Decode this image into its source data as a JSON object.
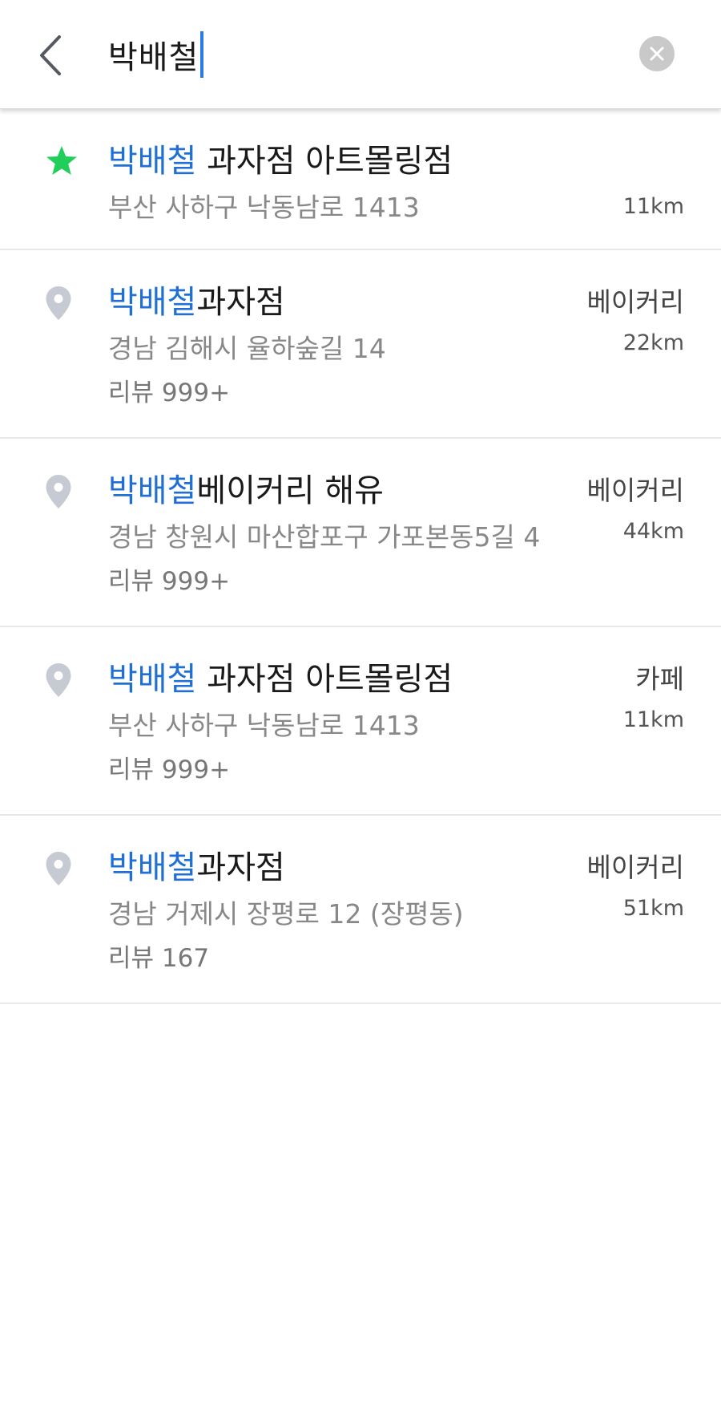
{
  "search": {
    "query": "박배철"
  },
  "colors": {
    "highlight": "#1f6fd6",
    "star": "#1fcf5a",
    "pin": "#c5cad3",
    "caret": "#2a7be4"
  },
  "icons": {
    "back": "chevron-left-icon",
    "clear": "clear-circle-icon",
    "favorite": "star-icon",
    "place": "map-pin-icon"
  },
  "results": [
    {
      "icon": "star",
      "name_highlight": "박배철",
      "name_rest": " 과자점 아트몰링점",
      "address": "부산 사하구 낙동남로 1413",
      "category": "",
      "distance": "11km",
      "reviews": ""
    },
    {
      "icon": "pin",
      "name_highlight": "박배철",
      "name_rest": "과자점",
      "address": "경남 김해시 율하숲길 14",
      "category": "베이커리",
      "distance": "22km",
      "reviews": "리뷰 999+"
    },
    {
      "icon": "pin",
      "name_highlight": "박배철",
      "name_rest": "베이커리 해유",
      "address": "경남 창원시 마산합포구 가포본동5길 4",
      "category": "베이커리",
      "distance": "44km",
      "reviews": "리뷰 999+"
    },
    {
      "icon": "pin",
      "name_highlight": "박배철",
      "name_rest": " 과자점 아트몰링점",
      "address": "부산 사하구 낙동남로 1413",
      "category": "카페",
      "distance": "11km",
      "reviews": "리뷰 999+"
    },
    {
      "icon": "pin",
      "name_highlight": "박배철",
      "name_rest": "과자점",
      "address": "경남 거제시 장평로 12 (장평동)",
      "category": "베이커리",
      "distance": "51km",
      "reviews": "리뷰 167"
    }
  ]
}
